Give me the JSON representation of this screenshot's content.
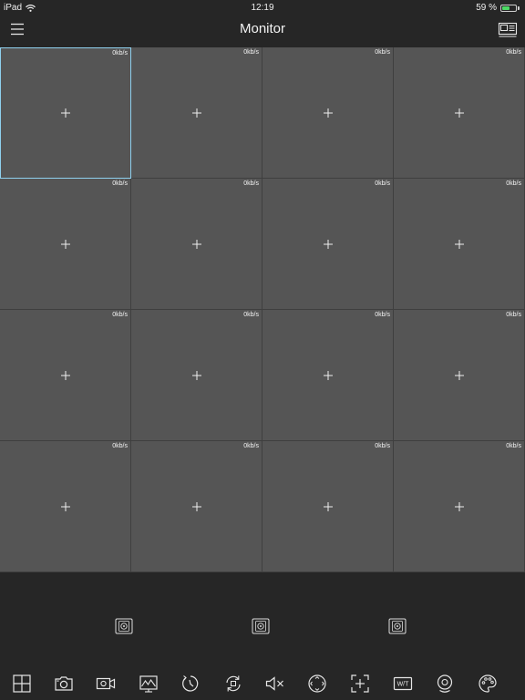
{
  "status_bar": {
    "device": "iPad",
    "time": "12:19",
    "battery_text": "59 %",
    "battery_level": 0.59,
    "battery_color": "#4cd964"
  },
  "nav": {
    "title": "Monitor",
    "menu_icon": "hamburger-menu-icon",
    "layout_icon": "window-layout-icon"
  },
  "grid": {
    "columns": 4,
    "rows": 4,
    "selected_index": 0,
    "selected_color": "#8fd0ee",
    "tiles": [
      {
        "rate": "0kb/s"
      },
      {
        "rate": "0kb/s"
      },
      {
        "rate": "0kb/s"
      },
      {
        "rate": "0kb/s"
      },
      {
        "rate": "0kb/s"
      },
      {
        "rate": "0kb/s"
      },
      {
        "rate": "0kb/s"
      },
      {
        "rate": "0kb/s"
      },
      {
        "rate": "0kb/s"
      },
      {
        "rate": "0kb/s"
      },
      {
        "rate": "0kb/s"
      },
      {
        "rate": "0kb/s"
      },
      {
        "rate": "0kb/s"
      },
      {
        "rate": "0kb/s"
      },
      {
        "rate": "0kb/s"
      },
      {
        "rate": "0kb/s"
      }
    ]
  },
  "presets": {
    "icons": [
      "preset-icon",
      "preset-icon",
      "preset-icon"
    ]
  },
  "toolbar": {
    "wt_label": "W/T",
    "icons": [
      "split-screen-icon",
      "snapshot-camera-icon",
      "record-video-icon",
      "image-settings-icon",
      "playback-clock-icon",
      "refresh-icon",
      "mute-speaker-icon",
      "ptz-control-icon",
      "digital-zoom-icon",
      "wide-tele-icon",
      "talk-icon",
      "color-palette-icon"
    ]
  }
}
